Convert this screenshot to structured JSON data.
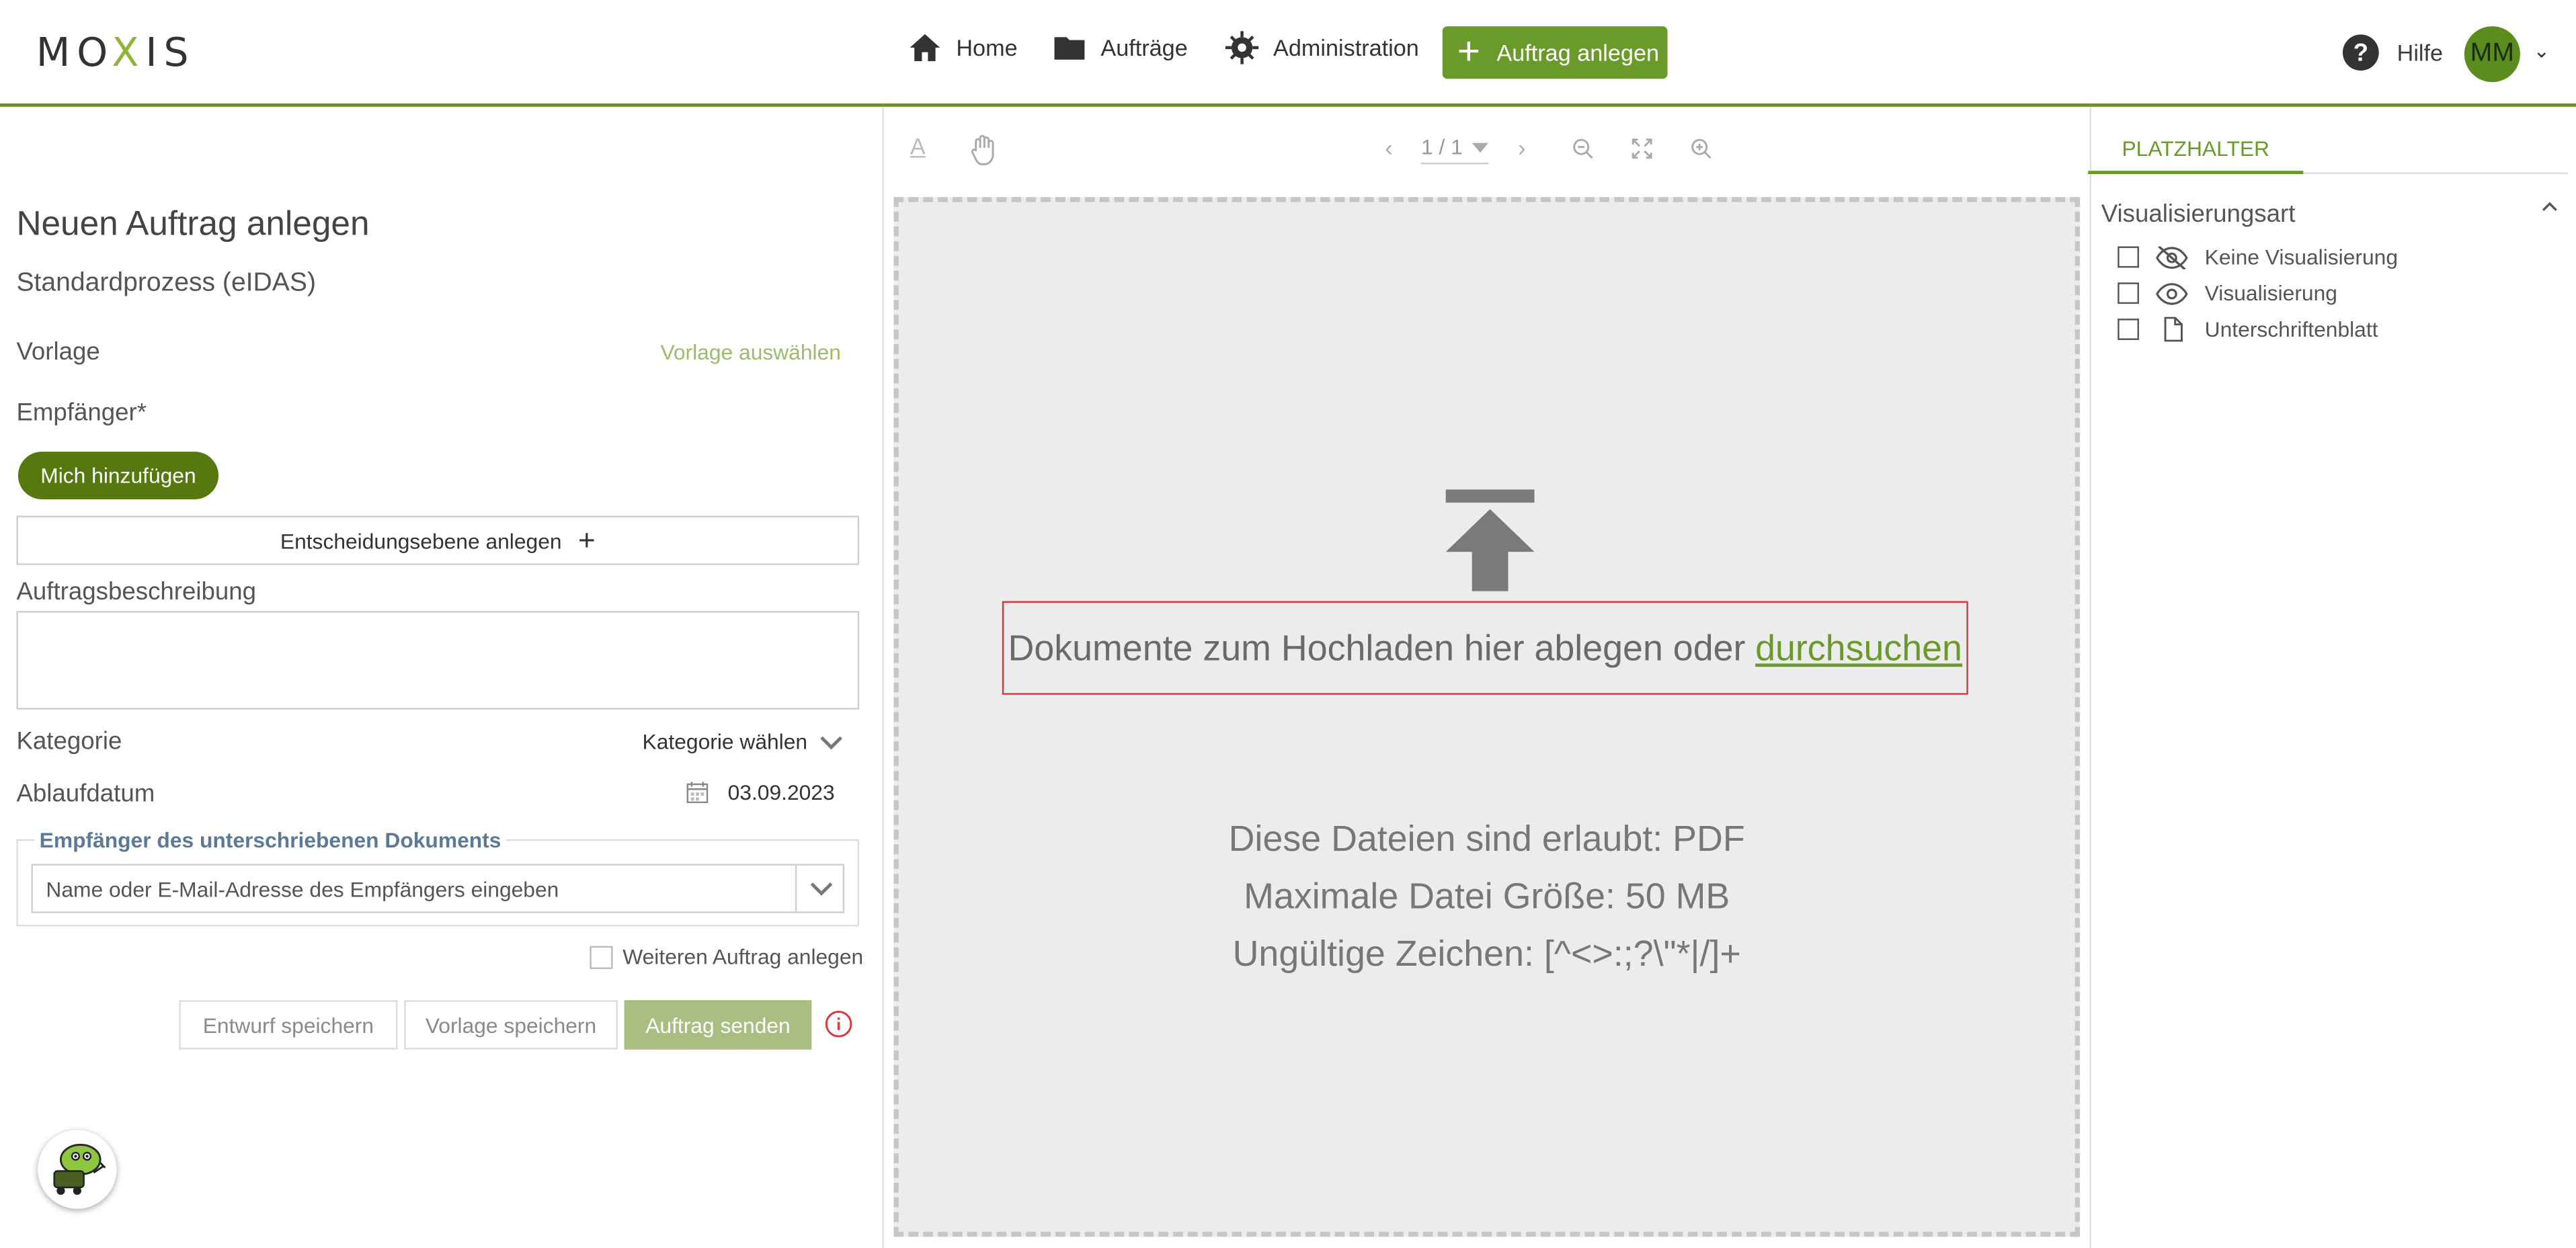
{
  "header": {
    "logo": "MOXIS",
    "nav": {
      "home": "Home",
      "orders": "Aufträge",
      "admin": "Administration",
      "new_order": "Auftrag anlegen"
    },
    "help": "Hilfe",
    "avatar_initials": "MM"
  },
  "left": {
    "title": "Neuen Auftrag anlegen",
    "process": "Standardprozess (eIDAS)",
    "template_label": "Vorlage",
    "template_action": "Vorlage auswählen",
    "recipient_label": "Empfänger*",
    "add_me": "Mich hinzufügen",
    "decision_level": "Entscheidungsebene anlegen",
    "description_label": "Auftragsbeschreibung",
    "category_label": "Kategorie",
    "category_select": "Kategorie wählen",
    "expiry_label": "Ablaufdatum",
    "expiry_value": "03.09.2023",
    "signed_recipient_legend": "Empfänger des unterschriebenen Dokuments",
    "signed_recipient_placeholder": "Name oder E-Mail-Adresse des Empfängers eingeben",
    "another_order": "Weiteren Auftrag anlegen",
    "save_draft": "Entwurf speichern",
    "save_template": "Vorlage speichern",
    "send_order": "Auftrag senden"
  },
  "viewer": {
    "page_indicator": "1 / 1",
    "drop_text": "Dokumente zum Hochladen hier ablegen oder",
    "browse_link": "durchsuchen",
    "allowed_files": "Diese Dateien sind erlaubt: PDF",
    "max_size": "Maximale Datei Größe: 50 MB",
    "invalid_chars": "Ungültige Zeichen: [^<>:;?\\\"*|/]+"
  },
  "right": {
    "tab": "PLATZHALTER",
    "section_title": "Visualisierungsart",
    "options": [
      "Keine Visualisierung",
      "Visualisierung",
      "Unterschriftenblatt"
    ]
  },
  "colors": {
    "accent": "#6a9a2a",
    "header_border": "#6f8f2a",
    "drop_highlight": "#d9363e"
  }
}
